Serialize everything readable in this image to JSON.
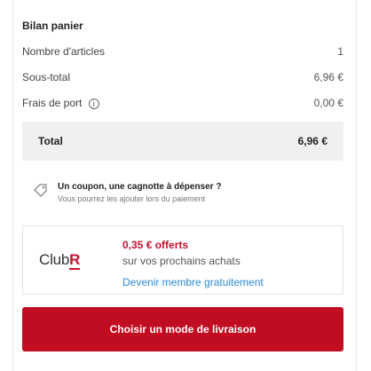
{
  "summary": {
    "title": "Bilan panier",
    "rows": [
      {
        "label": "Nombre d'articles",
        "value": "1"
      },
      {
        "label": "Sous-total",
        "value": "6,96 €"
      },
      {
        "label": "Frais de port",
        "value": "0,00 €"
      }
    ],
    "total_label": "Total",
    "total_value": "6,96 €"
  },
  "coupon": {
    "title": "Un coupon, une cagnotte à dépenser ?",
    "subtitle": "Vous pourrez les ajouter lors du paiement",
    "icon": "tag-icon"
  },
  "club": {
    "logo_text": "Club",
    "logo_letter": "R",
    "offer": "0,35 € offerts",
    "subtitle": "sur vos prochains achats",
    "link": "Devenir membre gratuitement"
  },
  "cta": {
    "label": "Choisir un mode de livraison"
  },
  "colors": {
    "brand_red": "#c10d21",
    "link_blue": "#2b8ad6",
    "total_bg": "#f0f0f0"
  }
}
